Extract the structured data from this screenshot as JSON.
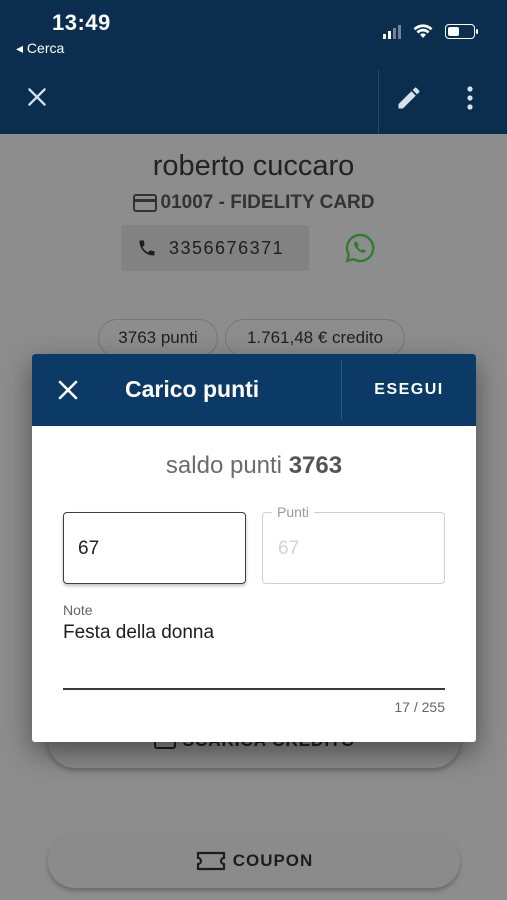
{
  "status_bar": {
    "time": "13:49",
    "back_label": "◂ Cerca"
  },
  "toolbar": {
    "close_icon": "close-icon",
    "edit_icon": "pencil-icon",
    "more_icon": "more-vert-icon"
  },
  "customer": {
    "name": "roberto cuccaro",
    "card": "01007 - FIDELITY CARD",
    "phone": "3356676371",
    "points_chip": "3763 punti",
    "credit_chip": "1.761,48 € credito"
  },
  "background_buttons": {
    "scarica_credito": "SCARICA CREDITO",
    "coupon": "COUPON"
  },
  "dialog": {
    "title": "Carico punti",
    "action": "ESEGUI",
    "saldo_prefix": "saldo punti",
    "saldo_value": "3763",
    "amount_value": "67",
    "points_label": "Punti",
    "points_value": "67",
    "note_label": "Note",
    "note_value": "Festa della donna",
    "note_counter": "17 / 255"
  },
  "colors": {
    "header": "#0b2e4f",
    "dialog_header": "#0b3a66",
    "whatsapp": "#2e7d32",
    "overlay_bg": "#8d8d8d"
  }
}
